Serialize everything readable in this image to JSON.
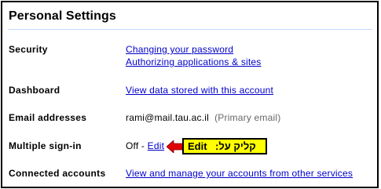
{
  "title": "Personal Settings",
  "colors": {
    "link": "#0000cc",
    "callout_bg": "#ffff00",
    "arrow": "#e00000",
    "rule": "#c3d9ff"
  },
  "rows": {
    "security": {
      "label": "Security",
      "link1": "Changing your password",
      "link2": "Authorizing applications & sites"
    },
    "dashboard": {
      "label": "Dashboard",
      "link": "View data stored with this account"
    },
    "email": {
      "label": "Email addresses",
      "address": "rami@mail.tau.ac.il",
      "note": "(Primary email)"
    },
    "multi": {
      "label": "Multiple sign-in",
      "status": "Off -",
      "edit": "Edit"
    },
    "connected": {
      "label": "Connected accounts",
      "link": "View and manage your accounts from other services"
    }
  },
  "callout": {
    "edit_word": "Edit",
    "hebrew_text": "קליק על:",
    "arrow_icon": "left-arrow-icon"
  }
}
